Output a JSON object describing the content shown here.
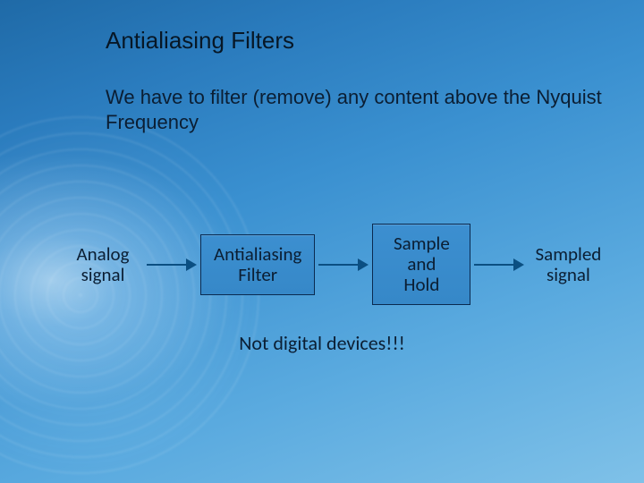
{
  "title": "Antialiasing Filters",
  "body": "We have to filter (remove) any content above the Nyquist Frequency",
  "flow": {
    "input_label_line1": "Analog",
    "input_label_line2": "signal",
    "box1_line1": "Antialiasing",
    "box1_line2": "Filter",
    "box2_line1": "Sample",
    "box2_line2": "and",
    "box2_line3": "Hold",
    "output_label_line1": "Sampled",
    "output_label_line2": "signal"
  },
  "note": "Not digital devices!!!"
}
